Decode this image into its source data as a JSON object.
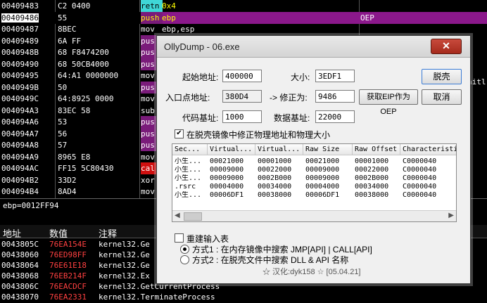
{
  "disasm": {
    "rows": [
      {
        "addr": "00409483",
        "hex": "C2 0400",
        "mnem": "retn",
        "op": "0x4",
        "comment": "",
        "hl": false,
        "mc": "#3fd7d7"
      },
      {
        "addr": "00409486",
        "hex": "55",
        "mnem": "push",
        "op": "ebp",
        "comment": "OEP",
        "hl": true,
        "mc": "#7a1b7a"
      },
      {
        "addr": "00409487",
        "hex": "8BEC",
        "mnem": "mov",
        "op": "ebp,esp",
        "comment": "",
        "hl": false,
        "mc": ""
      },
      {
        "addr": "00409489",
        "hex": "6A FF",
        "mnem": "pus",
        "op": "",
        "comment": "",
        "hl": false,
        "mc": "#7a1b7a"
      },
      {
        "addr": "0040948B",
        "hex": "68 F8474200",
        "mnem": "pus",
        "op": "",
        "comment": "",
        "hl": false,
        "mc": "#7a1b7a"
      },
      {
        "addr": "00409490",
        "hex": "68 50CB4000",
        "mnem": "pus",
        "op": "",
        "comment": "",
        "hl": false,
        "mc": "#7a1b7a"
      },
      {
        "addr": "00409495",
        "hex": "64:A1 0000000",
        "mnem": "mov",
        "op": "",
        "comment": "",
        "hl": false,
        "mc": ""
      },
      {
        "addr": "0040949B",
        "hex": "50",
        "mnem": "pus",
        "op": "",
        "comment": "",
        "hl": false,
        "mc": "#7a1b7a"
      },
      {
        "addr": "0040949C",
        "hex": "64:8925 0000",
        "mnem": "mov",
        "op": "",
        "comment": "",
        "hl": false,
        "mc": ""
      },
      {
        "addr": "004094A3",
        "hex": "83EC 58",
        "mnem": "sub",
        "op": "",
        "comment": "",
        "hl": false,
        "mc": ""
      },
      {
        "addr": "004094A6",
        "hex": "53",
        "mnem": "pus",
        "op": "",
        "comment": "",
        "hl": false,
        "mc": "#7a1b7a"
      },
      {
        "addr": "004094A7",
        "hex": "56",
        "mnem": "pus",
        "op": "",
        "comment": "",
        "hl": false,
        "mc": "#7a1b7a"
      },
      {
        "addr": "004094A8",
        "hex": "57",
        "mnem": "pus",
        "op": "",
        "comment": "",
        "hl": false,
        "mc": "#7a1b7a"
      },
      {
        "addr": "004094A9",
        "hex": "8965 E8",
        "mnem": "mov",
        "op": "",
        "comment": "",
        "hl": false,
        "mc": ""
      },
      {
        "addr": "004094AC",
        "hex": "FF15 5C80430",
        "mnem": "cal",
        "op": "",
        "comment": "",
        "hl": false,
        "mc": "#d01010"
      },
      {
        "addr": "004094B2",
        "hex": "33D2",
        "mnem": "xor",
        "op": "",
        "comment": "",
        "hl": false,
        "mc": ""
      },
      {
        "addr": "004094B4",
        "hex": "8AD4",
        "mnem": "mov",
        "op": "",
        "comment": "",
        "hl": false,
        "mc": ""
      },
      {
        "addr": "004094B6",
        "hex": "8915 C010430",
        "mnem": "mov",
        "op": "",
        "comment": "",
        "hl": false,
        "mc": ""
      }
    ],
    "right_fragment": "nitl"
  },
  "info_line": "ebp=0012FF94",
  "stack": {
    "headers": [
      "地址",
      "数值",
      "注释"
    ],
    "rows": [
      {
        "addr": "0043805C",
        "val": "76EA154E",
        "com": "kernel32.Ge"
      },
      {
        "addr": "00438060",
        "val": "76ED98FF",
        "com": "kernel32.Ge"
      },
      {
        "addr": "00438064",
        "val": "76E61E18",
        "com": "kernel32.Ge"
      },
      {
        "addr": "00438068",
        "val": "76EB214F",
        "com": "kernel32.Ex"
      },
      {
        "addr": "0043806C",
        "val": "76EACDCF",
        "com": "kernel32.GetCurrentProcess"
      },
      {
        "addr": "00438070",
        "val": "76EA2331",
        "com": "kernel32.TerminateProcess"
      }
    ]
  },
  "dialog": {
    "title": "OllyDump - 06.exe",
    "close": "✕",
    "start_addr_label": "起始地址:",
    "start_addr": "400000",
    "size_label": "大小:",
    "size": "3EDF1",
    "dump_button": "脱壳",
    "entry_label": "入口点地址:",
    "entry": "380D4",
    "modify_label": "-> 修正为:",
    "modify": "9486",
    "get_eip_button": "获取EIP作为OEP",
    "cancel_button": "取消",
    "code_base_label": "代码基址:",
    "code_base": "1000",
    "data_base_label": "数据基址:",
    "data_base": "22000",
    "fix_checkbox_label": "在脱壳镜像中修正物理地址和物理大小",
    "fix_checked": true,
    "table_headers": [
      "Sec...",
      "Virtual...",
      "Virtual...",
      "Raw Size",
      "Raw Offset",
      "Characteristic"
    ],
    "sections": [
      [
        "小生...",
        "00021000",
        "00001000",
        "00021000",
        "00001000",
        "C0000040"
      ],
      [
        "小生...",
        "00009000",
        "00022000",
        "00009000",
        "00022000",
        "C0000040"
      ],
      [
        "小生...",
        "00009000",
        "0002B000",
        "00009000",
        "0002B000",
        "C0000040"
      ],
      [
        ".rsrc",
        "00004000",
        "00034000",
        "00004000",
        "00034000",
        "C0000040"
      ],
      [
        "小生...",
        "00006DF1",
        "00038000",
        "00006DF1",
        "00038000",
        "C0000040"
      ]
    ],
    "rebuild_label": "重建输入表",
    "rebuild_checked": false,
    "mode1": "方式1 : 在内存镜像中搜索 JMP[API] | CALL[API]",
    "mode2": "方式2 : 在脱壳文件中搜索 DLL & API 名称",
    "footer": "☆ 汉化:dyk158 ☆ [05.04.21]"
  },
  "watermark": "看雪"
}
